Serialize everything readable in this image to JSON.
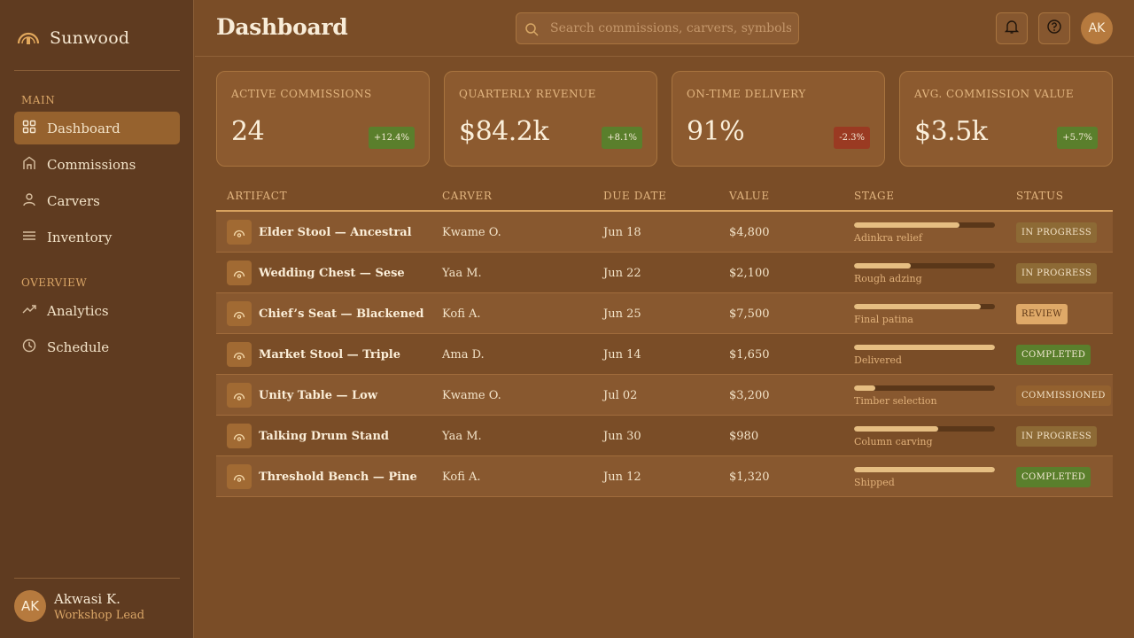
{
  "brand": {
    "name": "Sunwood"
  },
  "sidebar": {
    "sections": [
      {
        "label": "MAIN",
        "items": [
          {
            "label": "Dashboard",
            "icon": "grid-icon",
            "active": true
          },
          {
            "label": "Commissions",
            "icon": "building-icon",
            "active": false
          },
          {
            "label": "Carvers",
            "icon": "user-icon",
            "active": false
          },
          {
            "label": "Inventory",
            "icon": "list-icon",
            "active": false
          }
        ]
      },
      {
        "label": "OVERVIEW",
        "items": [
          {
            "label": "Analytics",
            "icon": "trend-icon",
            "active": false
          },
          {
            "label": "Schedule",
            "icon": "clock-icon",
            "active": false
          }
        ]
      }
    ],
    "user": {
      "initials": "AK",
      "name": "Akwasi K.",
      "role": "Workshop Lead"
    }
  },
  "header": {
    "title": "Dashboard",
    "search_placeholder": "Search commissions, carvers, symbols...",
    "avatar_initials": "AK"
  },
  "kpis": [
    {
      "label": "Active Commissions",
      "value": "24",
      "delta": "+12.4%",
      "trend": "up"
    },
    {
      "label": "Quarterly Revenue",
      "value": "$84.2k",
      "delta": "+8.1%",
      "trend": "up"
    },
    {
      "label": "On-Time Delivery",
      "value": "91%",
      "delta": "-2.3%",
      "trend": "down"
    },
    {
      "label": "Avg. Commission Value",
      "value": "$3.5k",
      "delta": "+5.7%",
      "trend": "up"
    }
  ],
  "table": {
    "columns": [
      "Artifact",
      "Carver",
      "Due Date",
      "Value",
      "Stage",
      "Status"
    ],
    "rows": [
      {
        "artifact": "Elder Stool — Ancestral",
        "carver": "Kwame O.",
        "due": "Jun 18",
        "value": "$4,800",
        "progress": 0.75,
        "stage": "Adinkra relief",
        "status": "In Progress",
        "status_kind": "progress"
      },
      {
        "artifact": "Wedding Chest — Sese",
        "carver": "Yaa M.",
        "due": "Jun 22",
        "value": "$2,100",
        "progress": 0.4,
        "stage": "Rough adzing",
        "status": "In Progress",
        "status_kind": "progress"
      },
      {
        "artifact": "Chief’s Seat — Blackened",
        "carver": "Kofi A.",
        "due": "Jun 25",
        "value": "$7,500",
        "progress": 0.9,
        "stage": "Final patina",
        "status": "Review",
        "status_kind": "review"
      },
      {
        "artifact": "Market Stool — Triple",
        "carver": "Ama D.",
        "due": "Jun 14",
        "value": "$1,650",
        "progress": 1.0,
        "stage": "Delivered",
        "status": "Completed",
        "status_kind": "complete"
      },
      {
        "artifact": "Unity Table — Low",
        "carver": "Kwame O.",
        "due": "Jul 02",
        "value": "$3,200",
        "progress": 0.15,
        "stage": "Timber selection",
        "status": "Commissioned",
        "status_kind": "commissioned"
      },
      {
        "artifact": "Talking Drum Stand",
        "carver": "Yaa M.",
        "due": "Jun 30",
        "value": "$980",
        "progress": 0.6,
        "stage": "Column carving",
        "status": "In Progress",
        "status_kind": "progress"
      },
      {
        "artifact": "Threshold Bench — Pine",
        "carver": "Kofi A.",
        "due": "Jun 12",
        "value": "$1,320",
        "progress": 1.0,
        "stage": "Shipped",
        "status": "Completed",
        "status_kind": "complete"
      }
    ]
  },
  "colors": {
    "accent": "#96622e",
    "background": "#7a4d27",
    "sidebar": "#5f3b20",
    "up": "#5a7f2c",
    "down": "#9a3a22"
  }
}
